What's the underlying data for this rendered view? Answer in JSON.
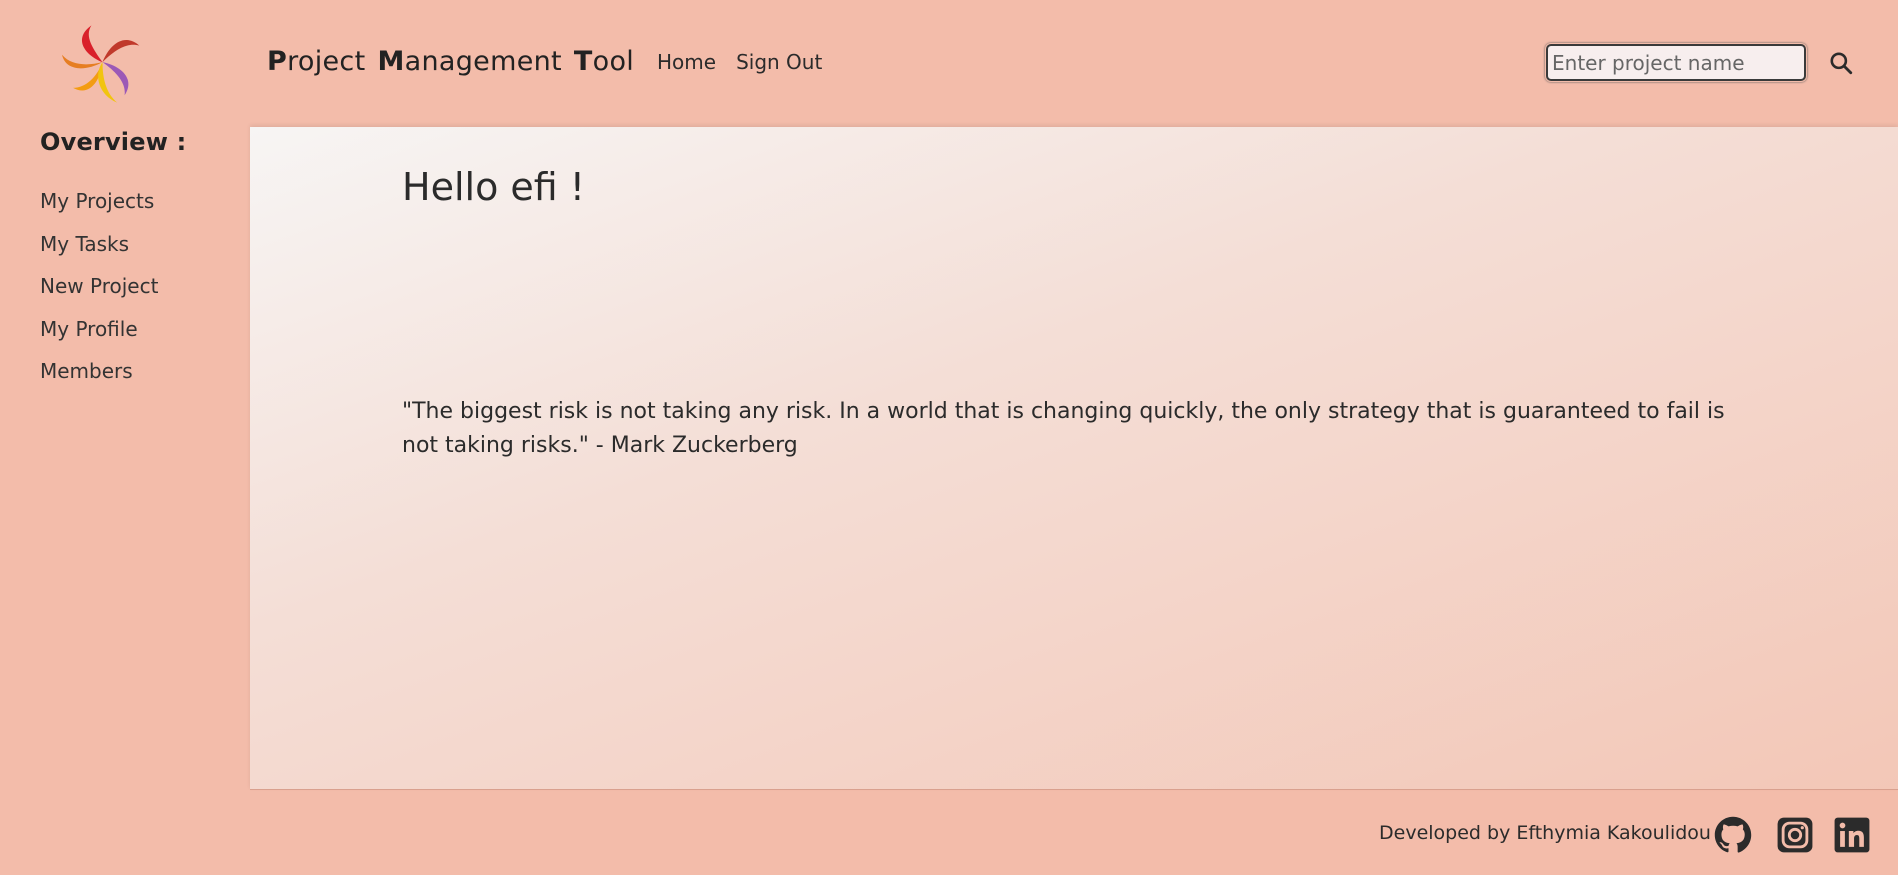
{
  "brand": {
    "words": [
      {
        "cap": "P",
        "rest": "roject"
      },
      {
        "cap": "M",
        "rest": "anagement"
      },
      {
        "cap": "T",
        "rest": "ool"
      }
    ]
  },
  "top_nav": {
    "home": "Home",
    "sign_out": "Sign Out"
  },
  "search": {
    "placeholder": "Enter project name",
    "value": ""
  },
  "sidebar": {
    "title": "Overview :",
    "items": [
      {
        "label": "My Projects"
      },
      {
        "label": "My Tasks"
      },
      {
        "label": "New Project"
      },
      {
        "label": "My Profile"
      },
      {
        "label": "Members"
      }
    ]
  },
  "main": {
    "greeting": "Hello efi !",
    "quote": "\"The biggest risk is not taking any risk. In a world that is changing quickly, the only strategy that is guaranteed to fail is not taking risks.\" - Mark Zuckerberg"
  },
  "footer": {
    "credit": "Developed by Efthymia Kakoulidou",
    "icons": [
      "github-icon",
      "instagram-icon",
      "linkedin-icon"
    ]
  },
  "colors": {
    "background": "#f3bcaa",
    "text": "#2b2b2b",
    "logo_red": "#d9202a",
    "logo_purple": "#9b59b6",
    "logo_orange": "#f39c12",
    "logo_yellow": "#f1c40f"
  }
}
